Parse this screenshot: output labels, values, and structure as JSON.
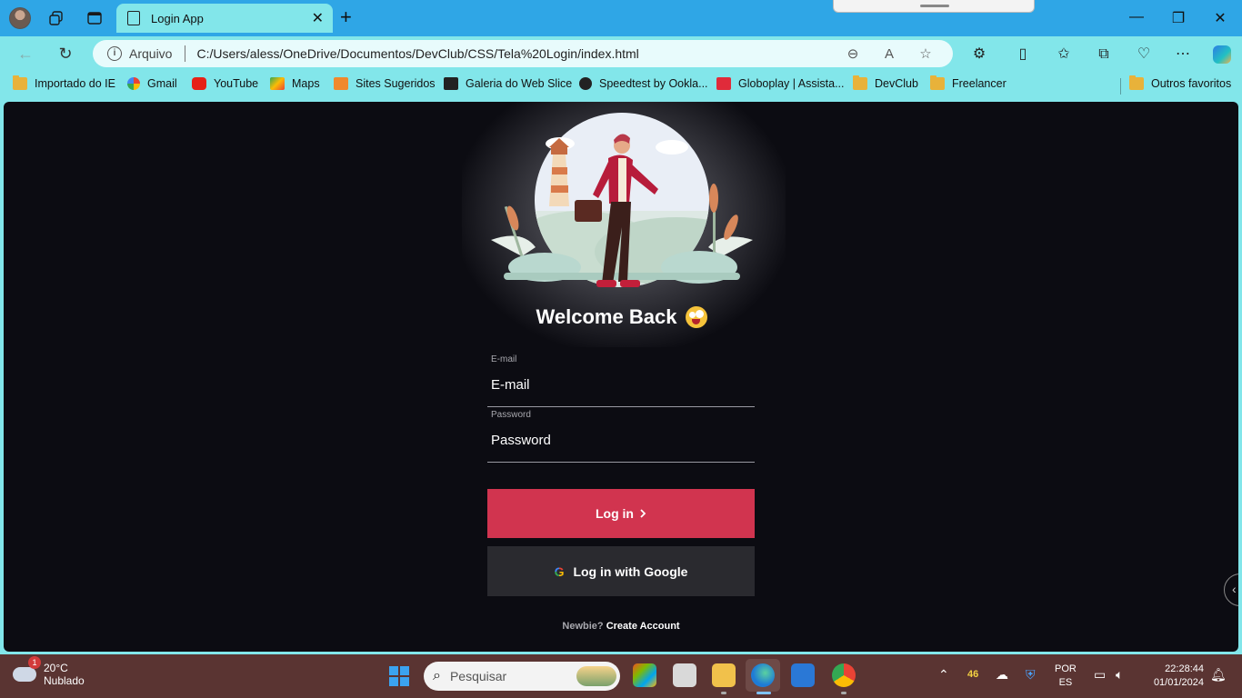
{
  "browser": {
    "tab_title": "Login App",
    "tab_close": "✕",
    "new_tab": "+",
    "address": {
      "scheme_label": "Arquivo",
      "url": "C:/Users/aless/OneDrive/Documentos/DevClub/CSS/Tela%20Login/index.html"
    },
    "bookmarks": [
      {
        "label": "Importado do IE",
        "icon": "folder-icon"
      },
      {
        "label": "Gmail",
        "icon": "google-icon"
      },
      {
        "label": "YouTube",
        "icon": "youtube-icon"
      },
      {
        "label": "Maps",
        "icon": "maps-icon"
      },
      {
        "label": "Sites Sugeridos",
        "icon": "suggested-sites-icon"
      },
      {
        "label": "Galeria do Web Slice",
        "icon": "web-slice-icon"
      },
      {
        "label": "Speedtest by Ookla...",
        "icon": "speedtest-icon"
      },
      {
        "label": "Globoplay | Assista...",
        "icon": "globoplay-icon"
      },
      {
        "label": "DevClub",
        "icon": "folder-icon"
      },
      {
        "label": "Freelancer",
        "icon": "folder-icon"
      }
    ],
    "other_favorites": "Outros favoritos"
  },
  "page": {
    "heading": "Welcome Back",
    "email": {
      "label": "E-mail",
      "placeholder": "E-mail"
    },
    "password": {
      "label": "Password",
      "placeholder": "Password"
    },
    "login_button": "Log in",
    "google_button": "Log in with Google",
    "signup_prompt": "Newbie?",
    "signup_link": "Create Account"
  },
  "taskbar": {
    "weather_temp": "20°C",
    "weather_desc": "Nublado",
    "weather_badge": "1",
    "search_placeholder": "Pesquisar",
    "language_top": "POR",
    "language_bottom": "ES",
    "time": "22:28:44",
    "date": "01/01/2024",
    "tray_temp_label": "46"
  },
  "colors": {
    "accent": "#d1344f",
    "page_bg": "#0c0c12",
    "browser_frame": "#82e6ea",
    "titlebar": "#2fa6e6",
    "taskbar": "#5a3432"
  }
}
